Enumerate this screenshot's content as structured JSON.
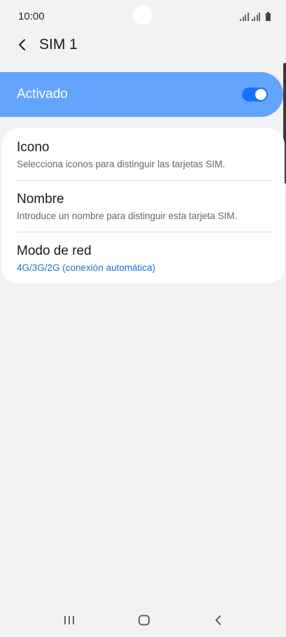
{
  "status_bar": {
    "time": "10:00"
  },
  "header": {
    "title": "SIM 1"
  },
  "activation": {
    "label": "Activado",
    "enabled": true,
    "accent_color": "#63a4ff",
    "toggle_color": "#1573ff"
  },
  "settings": {
    "items": [
      {
        "title": "Icono",
        "subtitle": "Selecciona iconos para distinguir las tarjetas SIM."
      },
      {
        "title": "Nombre",
        "subtitle": "Introduce un nombre para distinguir esta tarjeta SIM."
      },
      {
        "title": "Modo de red",
        "subtitle": "4G/3G/2G (conexión automática)"
      }
    ]
  },
  "nav_bar": {
    "icons": [
      "recent-apps-icon",
      "home-icon",
      "back-icon"
    ]
  }
}
